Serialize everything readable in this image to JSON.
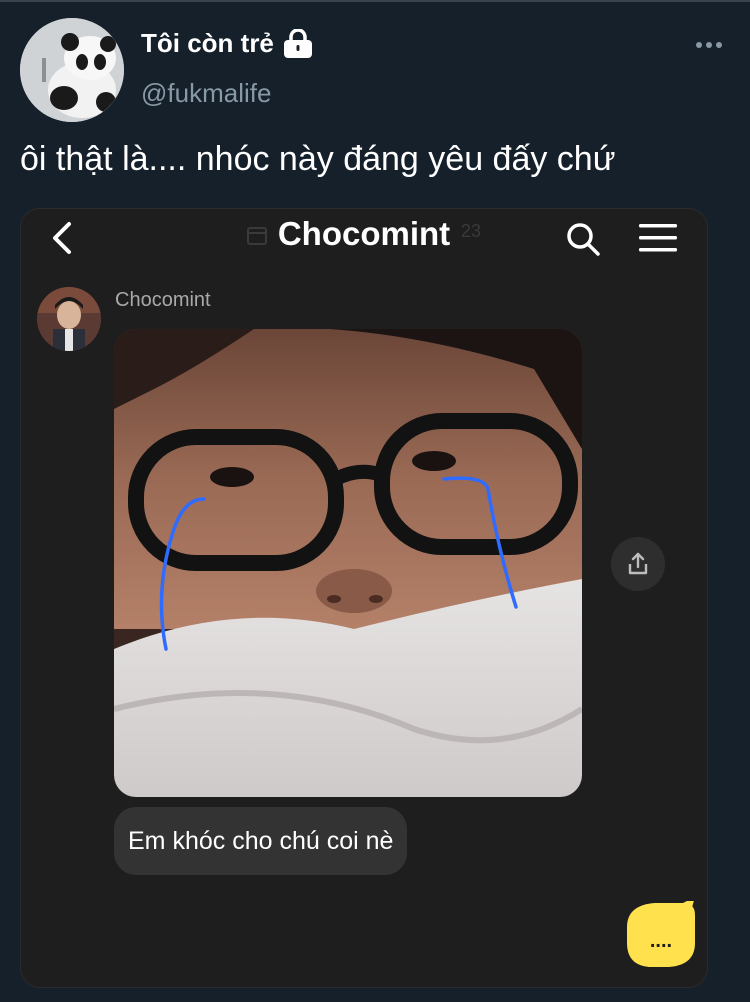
{
  "tweet": {
    "display_name": "Tôi còn trẻ",
    "handle": "@fukmalife",
    "text": "ôi thật là.... nhóc này đáng yêu đấy chứ",
    "avatar_icon": "panda-avatar",
    "more_icon": "more-horizontal-icon"
  },
  "embedded": {
    "title": "Chocomint",
    "ghost_number": "23",
    "sender_name": "Chocomint",
    "message": "Em khóc cho chú coi nè",
    "typing_indicator": "....",
    "colors": {
      "tear_lines": "#2f6bff",
      "typing_bubble": "#ffe14d",
      "card_bg": "#1e1e1e"
    }
  }
}
